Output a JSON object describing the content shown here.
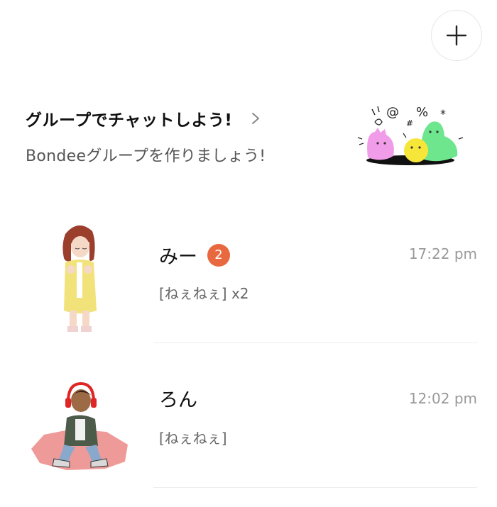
{
  "header": {
    "add_icon": "plus-icon"
  },
  "promo": {
    "title": "グループでチャットしよう!",
    "subtitle": "Bondeeグループを作りましょう!",
    "chevron_icon": "chevron-right-icon",
    "illustration_symbols": [
      "@",
      "#",
      "%",
      "*"
    ]
  },
  "chats": [
    {
      "name": "みー",
      "badge": "2",
      "time": "17:22 pm",
      "preview": "[ねぇねぇ]  x2"
    },
    {
      "name": "ろん",
      "time": "12:02 pm",
      "preview": "[ねぇねぇ]"
    }
  ],
  "colors": {
    "badge": "#e8683f",
    "time": "#999999",
    "preview": "#666666"
  }
}
